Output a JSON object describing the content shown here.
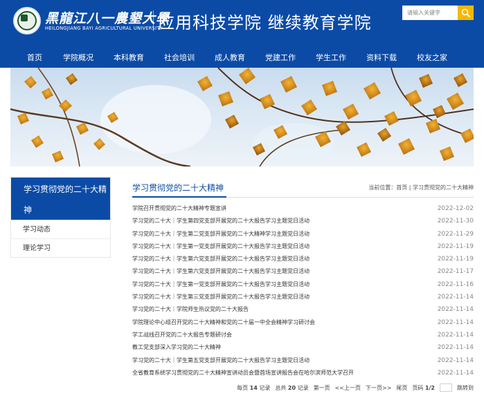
{
  "header": {
    "school_cn": "黑龍江八一農墾大學",
    "school_en": "HEILONGJIANG BAYI AGRICULTURAL UNIVERSITY",
    "site_title": "应用科技学院 继续教育学院",
    "logo_icon": "university-seal-icon",
    "search": {
      "placeholder": "请输入关键字",
      "button_icon": "search-icon"
    },
    "colors": {
      "primary": "#0b4ba6",
      "accent": "#f5b800"
    }
  },
  "nav": {
    "items": [
      {
        "label": "首页"
      },
      {
        "label": "学院概况"
      },
      {
        "label": "本科教育"
      },
      {
        "label": "社会培训"
      },
      {
        "label": "成人教育"
      },
      {
        "label": "党建工作"
      },
      {
        "label": "学生工作"
      },
      {
        "label": "资料下载"
      },
      {
        "label": "校友之家"
      }
    ]
  },
  "sidebar": {
    "title": "学习贯彻党的二十大精神",
    "items": [
      {
        "label": "学习动态"
      },
      {
        "label": "理论学习"
      }
    ]
  },
  "main": {
    "title": "学习贯彻党的二十大精神",
    "location_label": "当前位置：",
    "location_home": "首页",
    "location_sep": " | ",
    "location_current": "学习贯彻党的二十大精神",
    "articles": [
      {
        "title": "学院召开贯彻党的二十大精神专题宣讲",
        "date": "2022-12-02"
      },
      {
        "title": "学习党的二十大｜学生第四党支部开展党的二十大报告学习主题党日活动",
        "date": "2022-11-30"
      },
      {
        "title": "学习党的二十大｜学生第二党支部开展党的二十大精神学习主题党日活动",
        "date": "2022-11-29"
      },
      {
        "title": "学习党的二十大｜学生第一党支部开展党的二十大报告学习主题党日活动",
        "date": "2022-11-19"
      },
      {
        "title": "学习党的二十大｜学生第六党支部开展党的二十大报告学习主题党日活动",
        "date": "2022-11-19"
      },
      {
        "title": "学习党的二十大｜学生第六党支部开展党的二十大报告学习主题党日活动",
        "date": "2022-11-17"
      },
      {
        "title": "学习党的二十大｜学生第一党支部开展党的二十大报告学习主题党日活动",
        "date": "2022-11-16"
      },
      {
        "title": "学习党的二十大｜学生第三党支部开展党的二十大报告学习主题党日活动",
        "date": "2022-11-14"
      },
      {
        "title": "学习党的二十大｜学院师生热议党的二十大报告",
        "date": "2022-11-14"
      },
      {
        "title": "学院理论中心组召开党的二十大精神和党的二十届一中全会精神学习研讨会",
        "date": "2022-11-14"
      },
      {
        "title": "学工战线召开党的二十大报告专题研讨会",
        "date": "2022-11-14"
      },
      {
        "title": "教工党支部深入学习党的二十大精神",
        "date": "2022-11-14"
      },
      {
        "title": "学习党的二十大｜学生第五党支部开展党的二十大报告学习主题党日活动",
        "date": "2022-11-14"
      },
      {
        "title": "全省教育系统学习贯彻党的二十大精神宣讲动员会暨首场宣讲报告会在哈尔滨师范大学召开",
        "date": "2022-11-14"
      }
    ],
    "pager": {
      "per_page_label": "每页",
      "per_page": "14",
      "records_label": "记录",
      "total_label": "总共",
      "total": "20",
      "records_label2": "记录",
      "first": "第一页",
      "prev": "<<上一页",
      "next": "下一页>>",
      "last": "尾页",
      "page_label": "页码",
      "page": "1/2",
      "jump": "跳转到"
    }
  }
}
